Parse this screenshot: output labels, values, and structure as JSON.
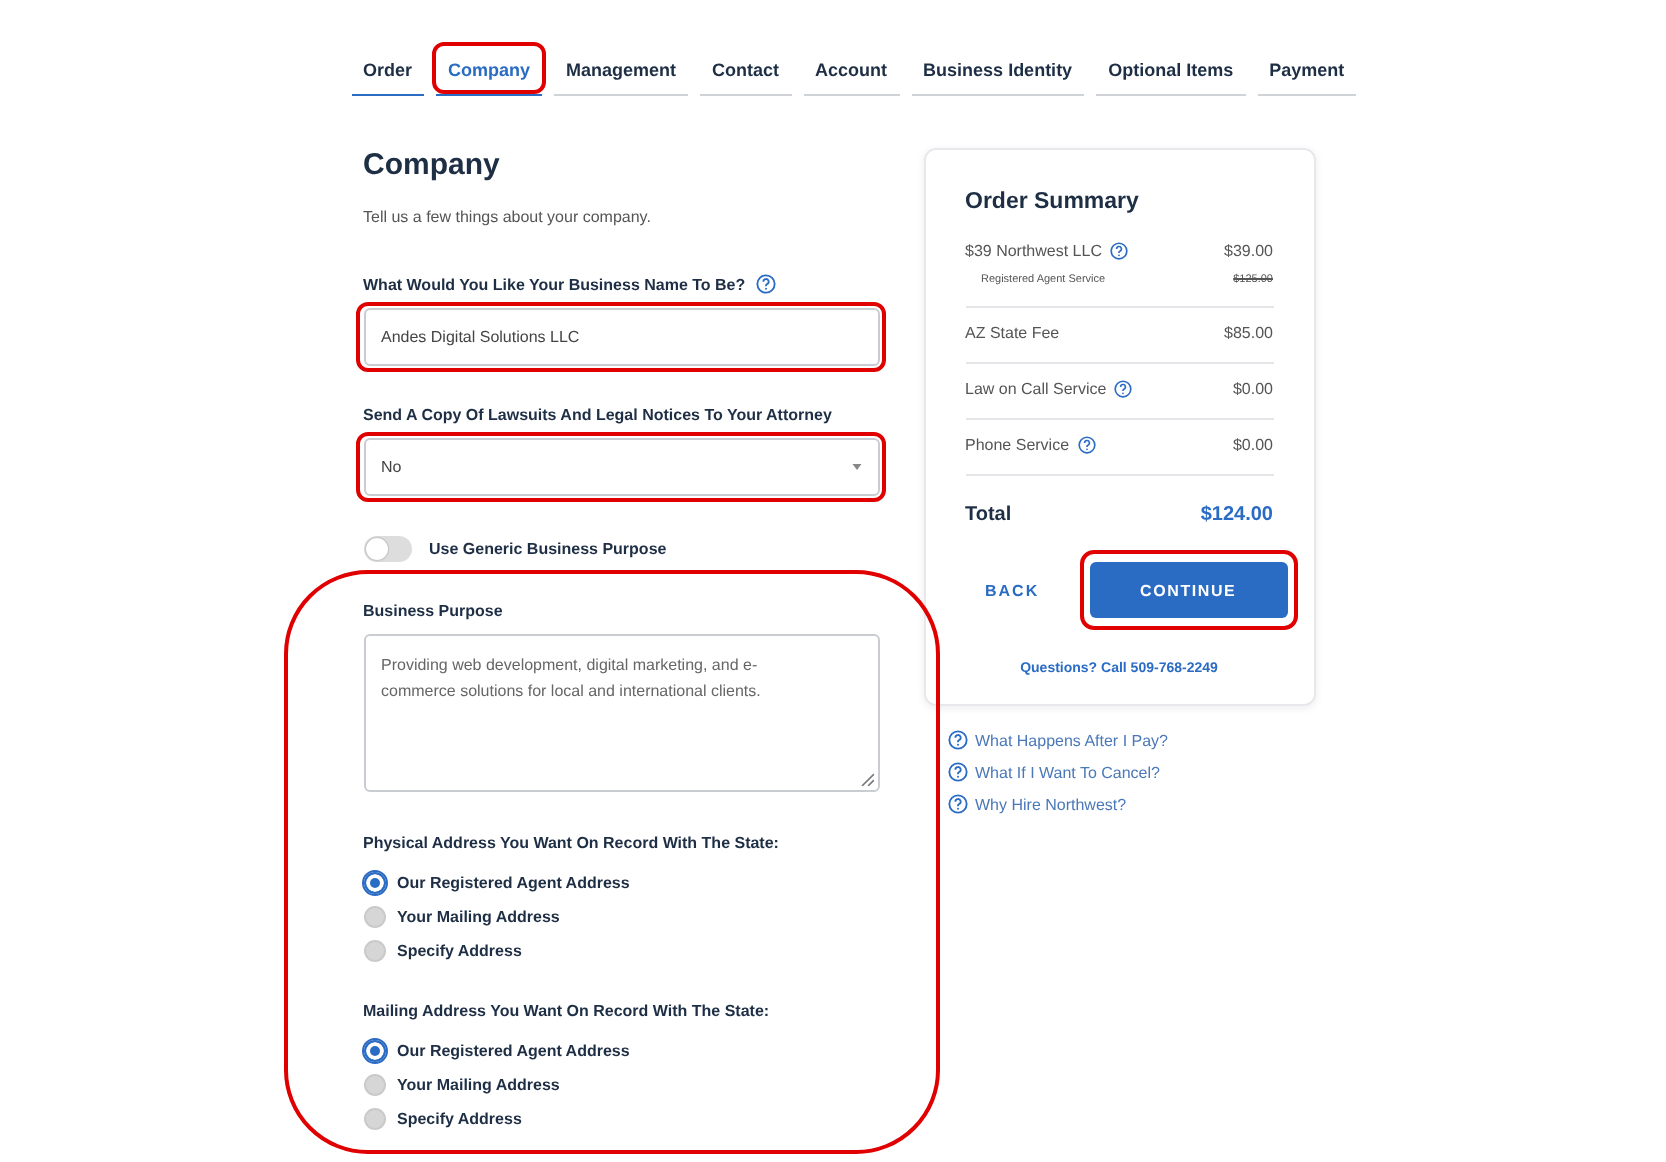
{
  "tabs": [
    {
      "label": "Order",
      "selected": false,
      "completed": true,
      "highlighted": false
    },
    {
      "label": "Company",
      "selected": true,
      "completed": false,
      "highlighted": true
    },
    {
      "label": "Management",
      "selected": false,
      "completed": false,
      "highlighted": false
    },
    {
      "label": "Contact",
      "selected": false,
      "completed": false,
      "highlighted": false
    },
    {
      "label": "Account",
      "selected": false,
      "completed": false,
      "highlighted": false
    },
    {
      "label": "Business Identity",
      "selected": false,
      "completed": false,
      "highlighted": false
    },
    {
      "label": "Optional Items",
      "selected": false,
      "completed": false,
      "highlighted": false
    },
    {
      "label": "Payment",
      "selected": false,
      "completed": false,
      "highlighted": false
    }
  ],
  "form": {
    "title": "Company",
    "subtitle": "Tell us a few things about your company.",
    "business_name": {
      "label": "What Would You Like Your Business Name To Be?",
      "help": true,
      "value": "Andes Digital Solutions LLC",
      "highlighted": true
    },
    "attorney_notice": {
      "label": "Send A Copy Of Lawsuits And Legal Notices To Your Attorney",
      "value": "No",
      "highlighted": true
    },
    "generic_purpose": {
      "label": "Use Generic Business Purpose",
      "on": false
    },
    "details_highlighted": true,
    "business_purpose": {
      "label": "Business Purpose",
      "value": "Providing web development, digital marketing, and e-commerce solutions for local and international clients."
    },
    "physical_address": {
      "label": "Physical Address You Want On Record With The State:",
      "options": [
        {
          "label": "Our Registered Agent Address",
          "selected": true
        },
        {
          "label": "Your Mailing Address",
          "selected": false
        },
        {
          "label": "Specify Address",
          "selected": false
        }
      ]
    },
    "mailing_address": {
      "label": "Mailing Address You Want On Record With The State:",
      "options": [
        {
          "label": "Our Registered Agent Address",
          "selected": true
        },
        {
          "label": "Your Mailing Address",
          "selected": false
        },
        {
          "label": "Specify Address",
          "selected": false
        }
      ]
    }
  },
  "summary": {
    "title": "Order Summary",
    "items": [
      {
        "kind": "line",
        "label": "$39 Northwest LLC",
        "help": true,
        "price": "$39.00"
      },
      {
        "kind": "subline",
        "label": "Registered Agent Service",
        "price": "$125.00",
        "struck": true
      },
      {
        "kind": "line",
        "label": "AZ State Fee",
        "help": false,
        "price": "$85.00"
      },
      {
        "kind": "line",
        "label": "Law on Call Service",
        "help": true,
        "price": "$0.00"
      },
      {
        "kind": "line",
        "label": "Phone Service",
        "help": true,
        "price": "$0.00"
      }
    ],
    "total": {
      "label": "Total",
      "value": "$124.00"
    },
    "back": {
      "label": "BACK"
    },
    "continue": {
      "label": "CONTINUE",
      "highlighted": true
    },
    "phone": "Questions? Call 509-768-2249"
  },
  "help_links": [
    "What Happens After I Pay?",
    "What If I Want To Cancel?",
    "Why Hire Northwest?"
  ]
}
